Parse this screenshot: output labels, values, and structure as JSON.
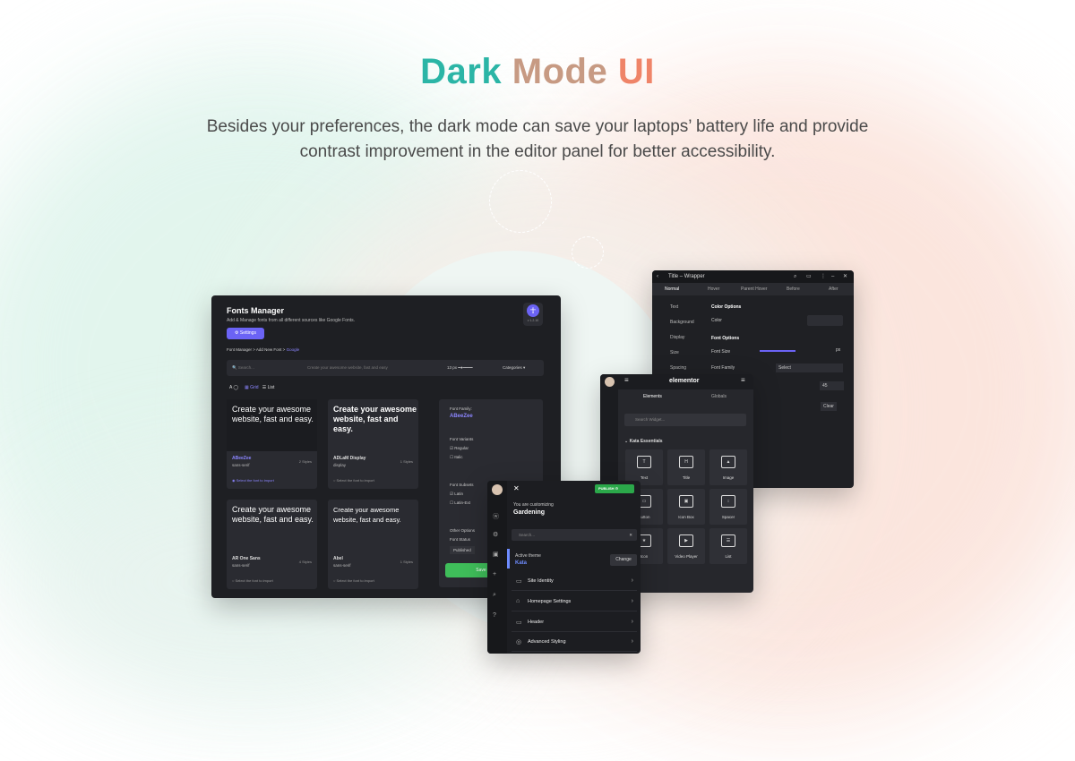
{
  "heading": {
    "part1": "Dark",
    "part2": "Mode",
    "part3": "UI"
  },
  "subtitle": "Besides your preferences, the dark mode can save your laptops’ battery life and provide contrast improvement in the editor panel for better accessibility.",
  "fonts_manager": {
    "title": "Fonts Manager",
    "description": "Add & Manage fonts from all different sources like Google Fonts.",
    "settings_button": "Settings",
    "version": "v 1.2.10",
    "breadcrumb": [
      "Font Manager",
      "Add New Font",
      "Google"
    ],
    "search_placeholder": "Search...",
    "preview_placeholder": "Create your awesome website, fast and easy",
    "size": "13 px",
    "categories": "Categories",
    "view_grid": "Grid",
    "view_list": "List",
    "cards": [
      {
        "text": "Create your awesome website, fast and easy.",
        "name": "ABeeZee",
        "type": "sans-serif",
        "styles": "2 Styles",
        "select": "Select the font to import"
      },
      {
        "text": "Create your awesome website, fast and easy.",
        "name": "ADLaM Display",
        "type": "display",
        "styles": "1 Styles",
        "select": "Select the font to import"
      },
      {
        "text": "Create your awesome website, fast and easy.",
        "name": "AR One Sans",
        "type": "sans-serif",
        "styles": "4 Styles",
        "select": "Select the font to import"
      },
      {
        "text": "Create your awesome website, fast and easy.",
        "name": "Abel",
        "type": "sans-serif",
        "styles": "1 Styles",
        "select": "Select the font to import"
      }
    ],
    "side": {
      "family_label": "Font Family:",
      "family_value": "ABeeZee",
      "variants_label": "Font Variants",
      "v1": "Regular",
      "v2": "Italic",
      "subsets_label": "Font Subsets",
      "s1": "Latin",
      "s2": "Latin-Ext",
      "other_label": "Other Options",
      "status_label": "Font Status",
      "status_value": "Published",
      "save": "Save"
    }
  },
  "title_wrapper": {
    "title": "Title – Wrapper",
    "tabs": [
      "Normal",
      "Hover",
      "Parent Hover",
      "Before",
      "After"
    ],
    "nav": [
      "Text",
      "Background",
      "Display",
      "Size",
      "Spacing"
    ],
    "color_options": "Color Options",
    "color": "Color",
    "font_options": "Font Options",
    "font_size": "Font Size",
    "font_size_unit": "px",
    "font_family": "Font Family",
    "select": "Select",
    "value": "45",
    "clear": "Clear"
  },
  "elementor": {
    "logo": "elementor",
    "tab_elements": "Elements",
    "tab_globals": "Globals",
    "search_placeholder": "Search Widget...",
    "section": "Kata Essentials",
    "widgets": [
      "Text",
      "Title",
      "Image",
      "Button",
      "Icon Box",
      "Spacer",
      "Icon",
      "Video Player",
      "List"
    ]
  },
  "customizer": {
    "publish": "PUBLISH",
    "you_are": "You are customizing",
    "site": "Gardening",
    "search_placeholder": "Search...",
    "active_theme": "Active theme",
    "theme_name": "Kata",
    "change": "Change",
    "rows": [
      "Site Identity",
      "Homepage Settings",
      "Header",
      "Advanced Styling"
    ]
  }
}
